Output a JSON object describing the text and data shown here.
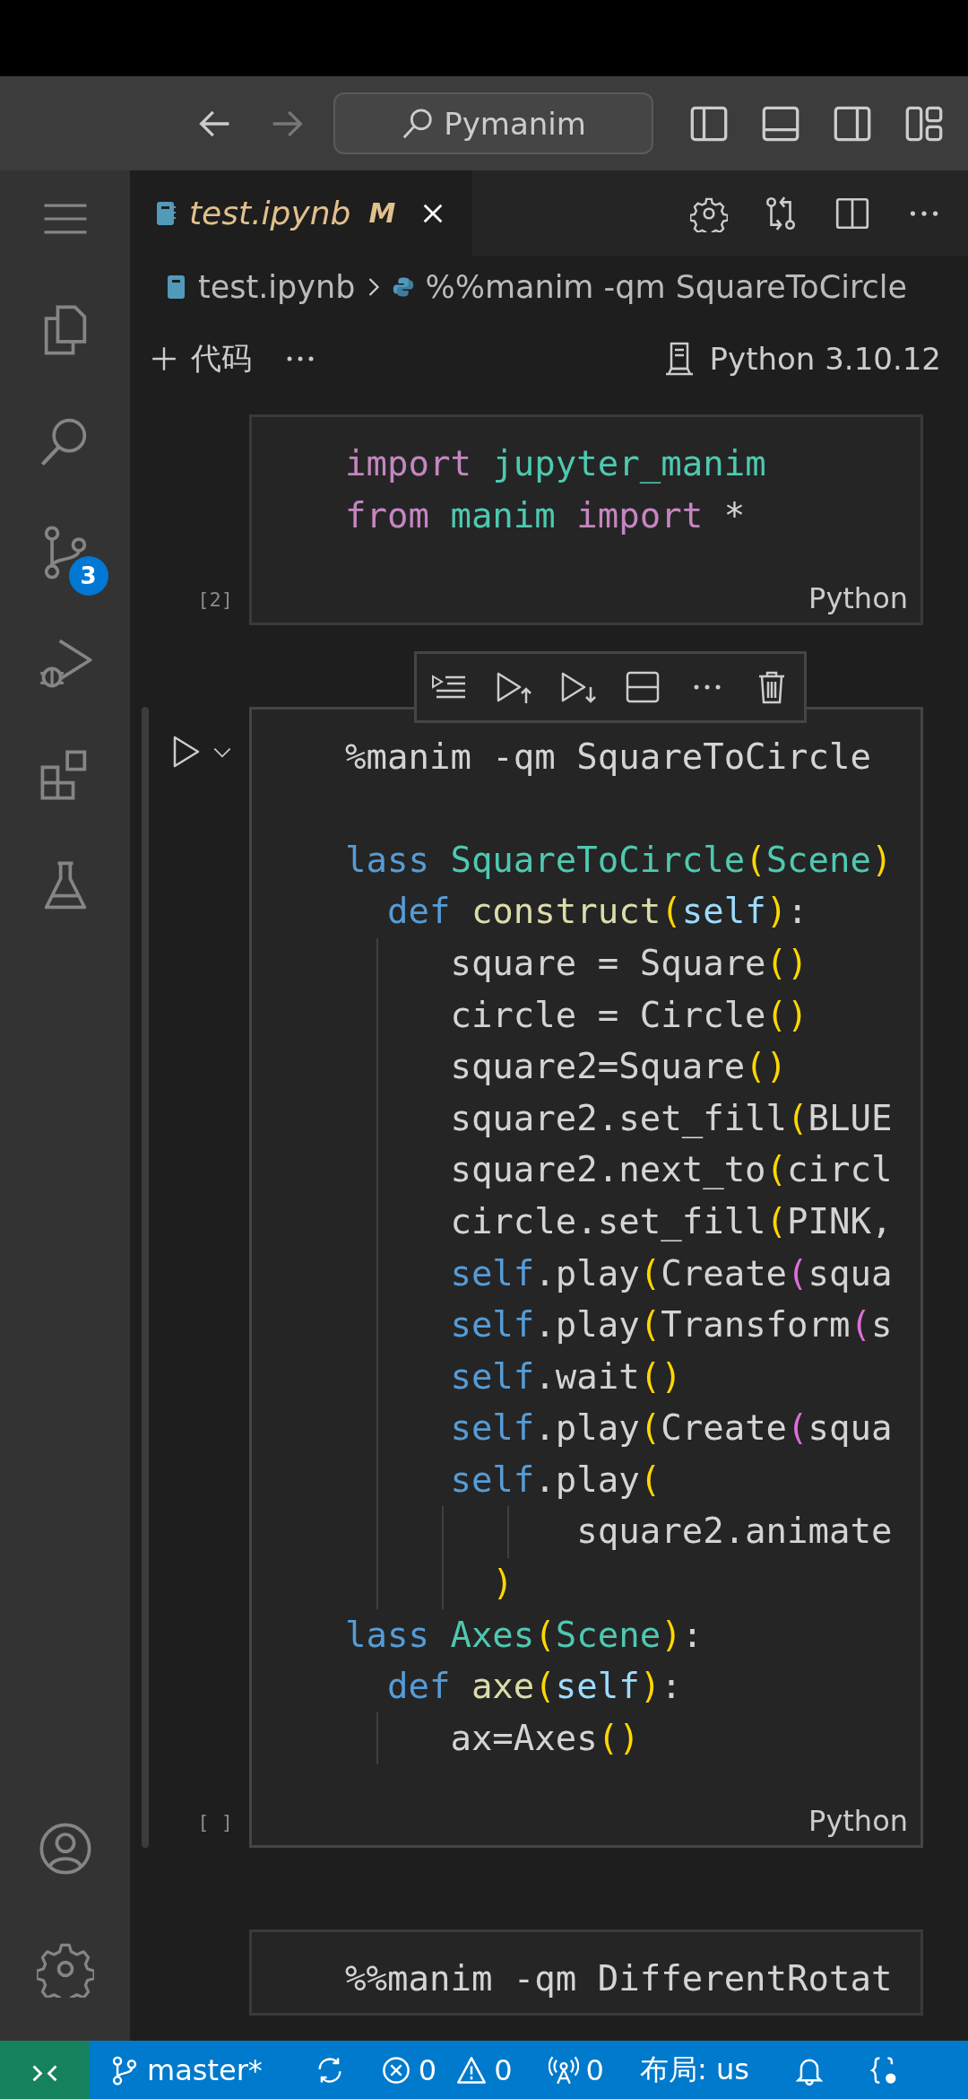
{
  "title_bar": {
    "search": "Pymanim"
  },
  "activity_bar": {
    "source_control_badge": "3"
  },
  "tabs": [
    {
      "label": "test.ipynb",
      "status": "M",
      "selected": true
    }
  ],
  "breadcrumb": [
    {
      "kind": "notebook",
      "label": "test.ipynb"
    },
    {
      "kind": "python",
      "label": "%%manim -qm SquareToCircle"
    }
  ],
  "notebook_toolbar": {
    "add_label": "代码",
    "kernel": "Python 3.10.12"
  },
  "cells": [
    {
      "selected": false,
      "execution_count": "[2]",
      "language": "Python",
      "lines": [
        {
          "kind": "code",
          "tokens": [
            {
              "text": "import ",
              "kind": "keyword"
            },
            {
              "text": "jupyter_manim",
              "kind": "module"
            }
          ]
        },
        {
          "kind": "code",
          "tokens": [
            {
              "text": "from ",
              "kind": "keyword"
            },
            {
              "text": "manim ",
              "kind": "module"
            },
            {
              "text": "import ",
              "kind": "keyword"
            },
            {
              "text": "*",
              "kind": "plain"
            }
          ]
        }
      ]
    },
    {
      "selected": true,
      "execution_count": "[ ]",
      "language": "Python",
      "lines": [
        {
          "kind": "code",
          "tokens": [
            {
              "text": "%manim -qm SquareToCircle",
              "kind": "plain"
            }
          ]
        },
        {
          "kind": "blank"
        },
        {
          "kind": "code",
          "tokens": [
            {
              "text": "lass ",
              "kind": "storage"
            },
            {
              "text": "SquareToCircle",
              "kind": "type"
            },
            {
              "text": "(",
              "kind": "bracket"
            },
            {
              "text": "Scene",
              "kind": "type"
            },
            {
              "text": ")",
              "kind": "bracket"
            }
          ]
        },
        {
          "kind": "code",
          "tokens": [
            {
              "text": "  def ",
              "kind": "storage"
            },
            {
              "text": "construct",
              "kind": "func"
            },
            {
              "text": "(",
              "kind": "bracket"
            },
            {
              "text": "self",
              "kind": "param"
            },
            {
              "text": ")",
              "kind": "bracket"
            },
            {
              "text": ":",
              "kind": "plain"
            }
          ]
        },
        {
          "kind": "code",
          "tokens": [
            {
              "text": "     square = Square",
              "kind": "plain"
            },
            {
              "text": "()",
              "kind": "bracket"
            }
          ]
        },
        {
          "kind": "code",
          "tokens": [
            {
              "text": "     circle = Circle",
              "kind": "plain"
            },
            {
              "text": "()",
              "kind": "bracket"
            }
          ]
        },
        {
          "kind": "code",
          "tokens": [
            {
              "text": "     square2=Square",
              "kind": "plain"
            },
            {
              "text": "()",
              "kind": "bracket"
            }
          ]
        },
        {
          "kind": "code",
          "tokens": [
            {
              "text": "     square2.set_fill",
              "kind": "plain"
            },
            {
              "text": "(",
              "kind": "bracket"
            },
            {
              "text": "BLUE",
              "kind": "plain"
            }
          ]
        },
        {
          "kind": "code",
          "tokens": [
            {
              "text": "     square2.next_to",
              "kind": "plain"
            },
            {
              "text": "(",
              "kind": "bracket"
            },
            {
              "text": "circl",
              "kind": "plain"
            }
          ]
        },
        {
          "kind": "code",
          "tokens": [
            {
              "text": "     circle.set_fill",
              "kind": "plain"
            },
            {
              "text": "(",
              "kind": "bracket"
            },
            {
              "text": "PINK,",
              "kind": "plain"
            }
          ]
        },
        {
          "kind": "code",
          "tokens": [
            {
              "text": "     self",
              "kind": "storage"
            },
            {
              "text": ".play",
              "kind": "plain"
            },
            {
              "text": "(",
              "kind": "bracket"
            },
            {
              "text": "Create",
              "kind": "plain"
            },
            {
              "text": "(",
              "kind": "bracket2"
            },
            {
              "text": "squa",
              "kind": "plain"
            }
          ]
        },
        {
          "kind": "code",
          "tokens": [
            {
              "text": "     self",
              "kind": "storage"
            },
            {
              "text": ".play",
              "kind": "plain"
            },
            {
              "text": "(",
              "kind": "bracket"
            },
            {
              "text": "Transform",
              "kind": "plain"
            },
            {
              "text": "(",
              "kind": "bracket2"
            },
            {
              "text": "s",
              "kind": "plain"
            }
          ]
        },
        {
          "kind": "code",
          "tokens": [
            {
              "text": "     self",
              "kind": "storage"
            },
            {
              "text": ".wait",
              "kind": "plain"
            },
            {
              "text": "()",
              "kind": "bracket"
            }
          ]
        },
        {
          "kind": "code",
          "tokens": [
            {
              "text": "     self",
              "kind": "storage"
            },
            {
              "text": ".play",
              "kind": "plain"
            },
            {
              "text": "(",
              "kind": "bracket"
            },
            {
              "text": "Create",
              "kind": "plain"
            },
            {
              "text": "(",
              "kind": "bracket2"
            },
            {
              "text": "squa",
              "kind": "plain"
            }
          ]
        },
        {
          "kind": "code",
          "tokens": [
            {
              "text": "     self",
              "kind": "storage"
            },
            {
              "text": ".play",
              "kind": "plain"
            },
            {
              "text": "(",
              "kind": "bracket"
            }
          ]
        },
        {
          "kind": "code",
          "tokens": [
            {
              "text": "           square2.animate",
              "kind": "plain"
            }
          ]
        },
        {
          "kind": "code",
          "tokens": [
            {
              "text": "       )",
              "kind": "bracket"
            }
          ]
        },
        {
          "kind": "code",
          "tokens": [
            {
              "text": "lass ",
              "kind": "storage"
            },
            {
              "text": "Axes",
              "kind": "type"
            },
            {
              "text": "(",
              "kind": "bracket"
            },
            {
              "text": "Scene",
              "kind": "type"
            },
            {
              "text": ")",
              "kind": "bracket"
            },
            {
              "text": ":",
              "kind": "plain"
            }
          ]
        },
        {
          "kind": "code",
          "tokens": [
            {
              "text": "  def ",
              "kind": "storage"
            },
            {
              "text": "axe",
              "kind": "func"
            },
            {
              "text": "(",
              "kind": "bracket"
            },
            {
              "text": "self",
              "kind": "param"
            },
            {
              "text": ")",
              "kind": "bracket"
            },
            {
              "text": ":",
              "kind": "plain"
            }
          ]
        },
        {
          "kind": "code",
          "tokens": [
            {
              "text": "     ax=Axes",
              "kind": "plain"
            },
            {
              "text": "()",
              "kind": "bracket"
            }
          ]
        }
      ]
    },
    {
      "selected": false,
      "lines": [
        {
          "kind": "code",
          "tokens": [
            {
              "text": "%%manim -qm DifferentRotat",
              "kind": "plain"
            }
          ]
        }
      ]
    }
  ],
  "status_bar": {
    "branch": "master*",
    "errors": "0",
    "warnings": "0",
    "ports": "0",
    "layout": "布局: us"
  }
}
